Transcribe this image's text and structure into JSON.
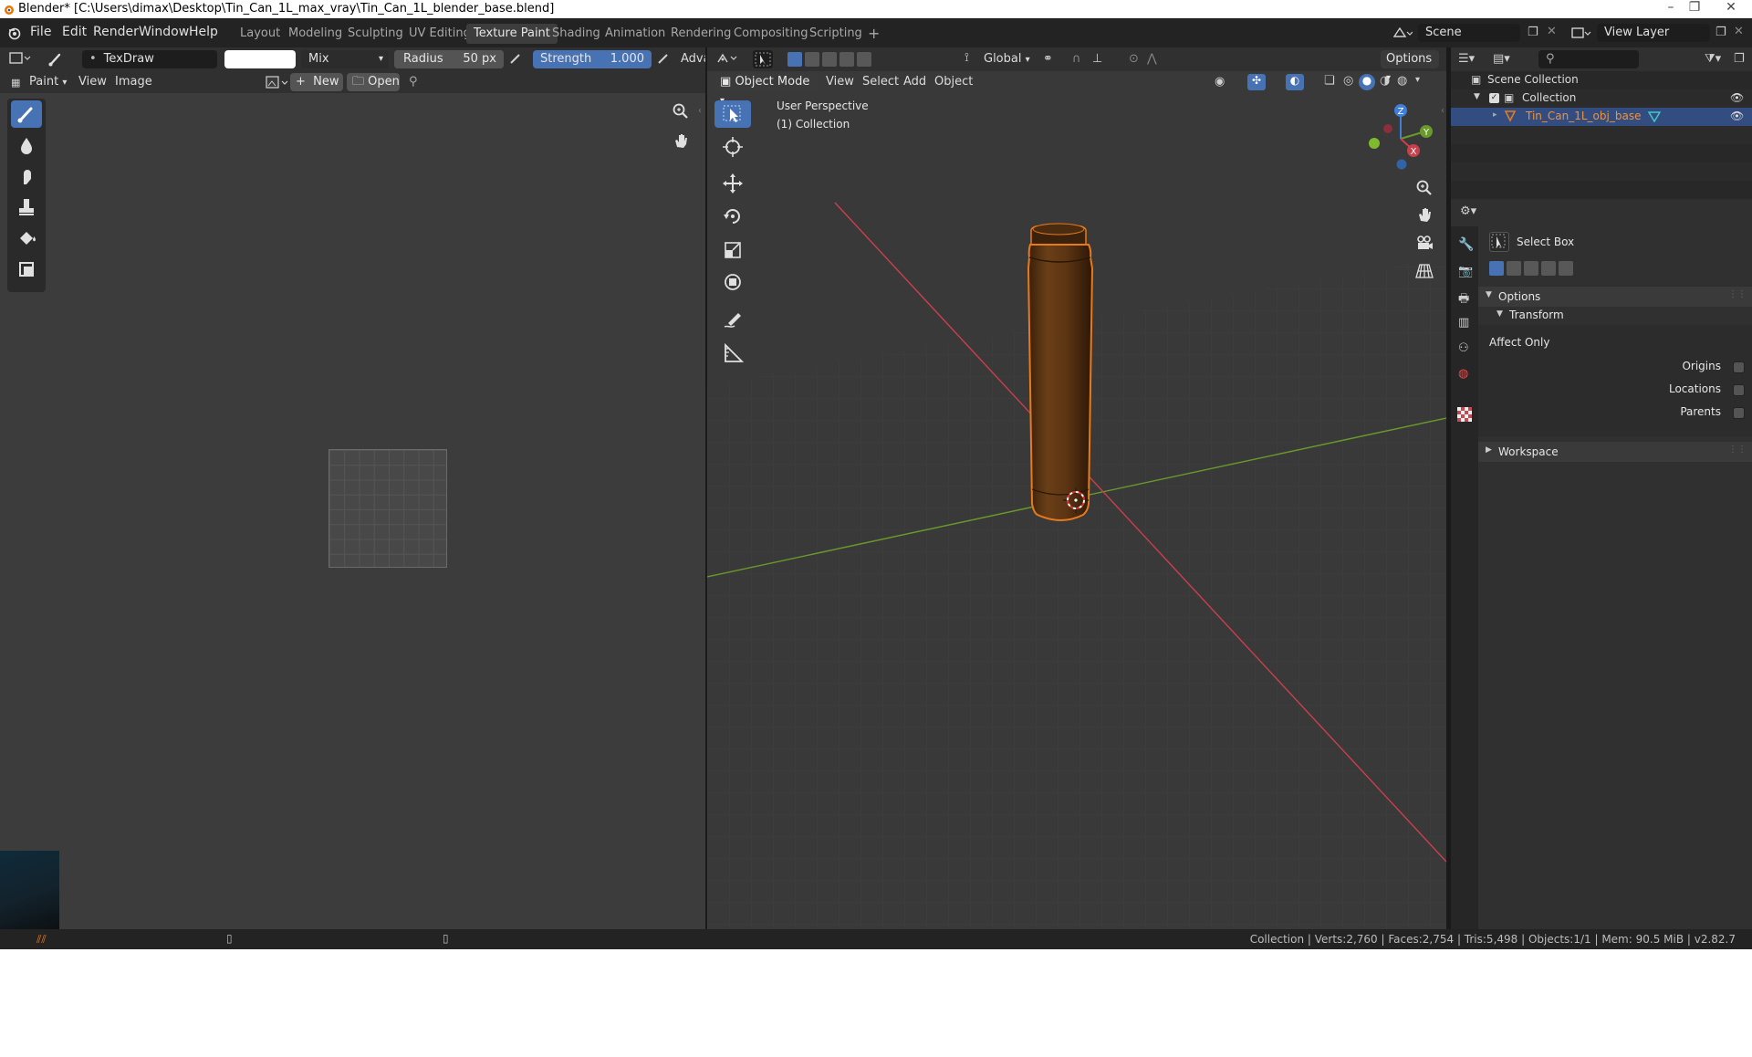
{
  "window": {
    "title": "Blender* [C:\\Users\\dimax\\Desktop\\Tin_Can_1L_max_vray\\Tin_Can_1L_blender_base.blend]"
  },
  "menus": [
    "File",
    "Edit",
    "Render",
    "Window",
    "Help"
  ],
  "workspaces": [
    "Layout",
    "Modeling",
    "Sculpting",
    "UV Editing",
    "Texture Paint",
    "Shading",
    "Animation",
    "Rendering",
    "Compositing",
    "Scripting"
  ],
  "active_workspace": "Texture Paint",
  "scene": {
    "label": "Scene",
    "view_layer": "View Layer"
  },
  "paint_header": {
    "brush_name": "TexDraw",
    "blend_mode": "Mix",
    "radius_label": "Radius",
    "radius_value": "50 px",
    "strength_label": "Strength",
    "strength_value": "1.000",
    "advanced": "Adva"
  },
  "image_editor": {
    "mode": "Paint",
    "menus": [
      "View",
      "Image"
    ],
    "new_label": "New",
    "open_label": "Open"
  },
  "viewport": {
    "mode": "Object Mode",
    "menus": [
      "View",
      "Select",
      "Add",
      "Object"
    ],
    "orientation": "Global",
    "options_label": "Options",
    "overlay_line1": "User Perspective",
    "overlay_line2": "(1) Collection",
    "gizmo_axes": {
      "z": "Z",
      "y": "Y",
      "x": "X"
    }
  },
  "outliner": {
    "root": "Scene Collection",
    "collection": "Collection",
    "object": "Tin_Can_1L_obj_base"
  },
  "properties": {
    "tool_name": "Select Box",
    "options_panel": "Options",
    "transform_subpanel": "Transform",
    "affect_only": "Affect Only",
    "checks": [
      "Origins",
      "Locations",
      "Parents"
    ],
    "workspace_panel": "Workspace"
  },
  "status_bar": {
    "text": "Collection | Verts:2,760 | Faces:2,754 | Tris:5,498 | Objects:1/1 | Mem: 90.5 MiB | v2.82.7"
  },
  "colors": {
    "accent": "#4772b3",
    "selected_object": "#e77a1b",
    "axis_x": "#c9404d",
    "axis_y": "#6a9a2a",
    "can_body": "#5b3413"
  }
}
